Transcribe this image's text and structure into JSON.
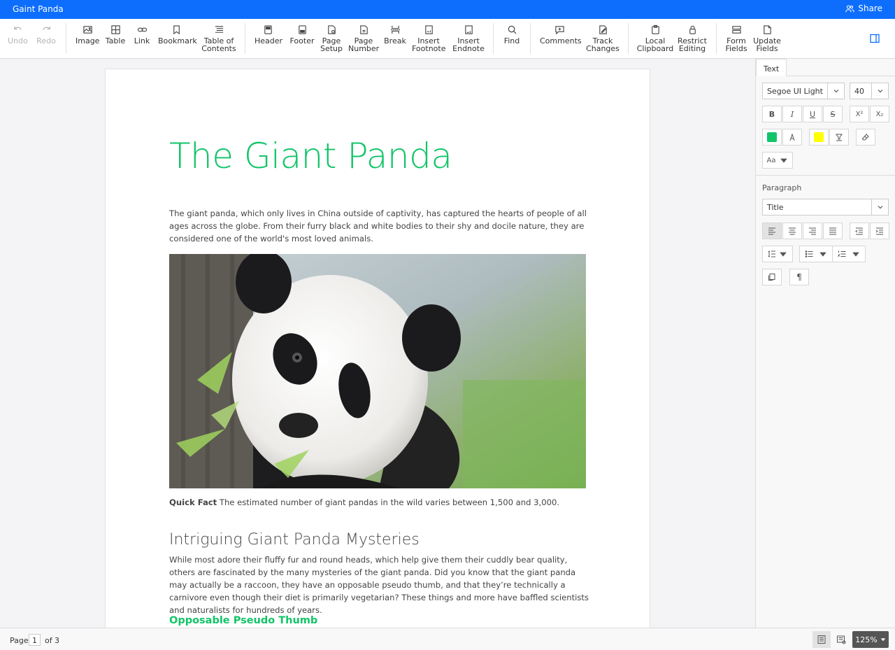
{
  "app": {
    "title": "Gaint Panda",
    "share_label": "Share"
  },
  "toolbar": {
    "items": [
      {
        "label": "Undo",
        "icon": "undo-icon",
        "enabled": false
      },
      {
        "label": "Redo",
        "icon": "redo-icon",
        "enabled": false
      },
      {
        "label": "Image",
        "icon": "image-icon"
      },
      {
        "label": "Table",
        "icon": "table-icon"
      },
      {
        "label": "Link",
        "icon": "link-icon"
      },
      {
        "label": "Bookmark",
        "icon": "bookmark-icon"
      },
      {
        "label": "Table of",
        "label2": "Contents",
        "icon": "toc-icon"
      },
      {
        "label": "Header",
        "icon": "header-icon"
      },
      {
        "label": "Footer",
        "icon": "footer-icon"
      },
      {
        "label": "Page",
        "label2": "Setup",
        "icon": "page-setup-icon"
      },
      {
        "label": "Page",
        "label2": "Number",
        "icon": "page-number-icon"
      },
      {
        "label": "Break",
        "icon": "break-icon"
      },
      {
        "label": "Insert",
        "label2": "Footnote",
        "icon": "footnote-icon"
      },
      {
        "label": "Insert",
        "label2": "Endnote",
        "icon": "endnote-icon"
      },
      {
        "label": "Find",
        "icon": "search-icon"
      },
      {
        "label": "Comments",
        "icon": "comment-icon"
      },
      {
        "label": "Track",
        "label2": "Changes",
        "icon": "track-changes-icon"
      },
      {
        "label": "Local",
        "label2": "Clipboard",
        "icon": "clipboard-icon"
      },
      {
        "label": "Restrict",
        "label2": "Editing",
        "icon": "lock-icon"
      },
      {
        "label": "Form",
        "label2": "Fields",
        "icon": "form-fields-icon"
      },
      {
        "label": "Update",
        "label2": "Fields",
        "icon": "update-fields-icon"
      }
    ]
  },
  "document": {
    "title": "The Giant Panda",
    "intro": "The giant panda, which only lives in China outside of captivity, has captured the hearts of people of all ages across the globe. From their furry black and white bodies to their shy and docile nature, they are considered one of the world's most loved animals.",
    "caption_bold": "Quick Fact",
    "caption_text": " The estimated number of giant pandas in the wild varies between 1,500 and 3,000.",
    "heading2": "Intriguing Giant Panda Mysteries",
    "mysteries": "While most adore their fluffy fur and round heads, which help give them their cuddly bear quality, others are fascinated by the many mysteries of the giant panda. Did you know that the giant panda may actually be a raccoon, they have an opposable pseudo thumb, and that they’re technically a carnivore even though their diet is primarily vegetarian? These things and more have baffled scientists and naturalists for hundreds of years.",
    "heading3": "Opposable Pseudo Thumb",
    "accent_color": "#12c468"
  },
  "panel": {
    "tab": "Text",
    "font_family": "Segoe UI Light",
    "font_size": "40",
    "bold": "B",
    "italic": "I",
    "underline": "U",
    "strike": "S",
    "superscript": "X²",
    "subscript": "X₂",
    "font_color": "#12c468",
    "highlight_color": "#ffff00",
    "case_label": "Aa",
    "paragraph_label": "Paragraph",
    "style": "Title"
  },
  "status": {
    "page_label": "Page",
    "page_current": "1",
    "of_label": "of",
    "page_total": "3",
    "zoom": "125%"
  }
}
